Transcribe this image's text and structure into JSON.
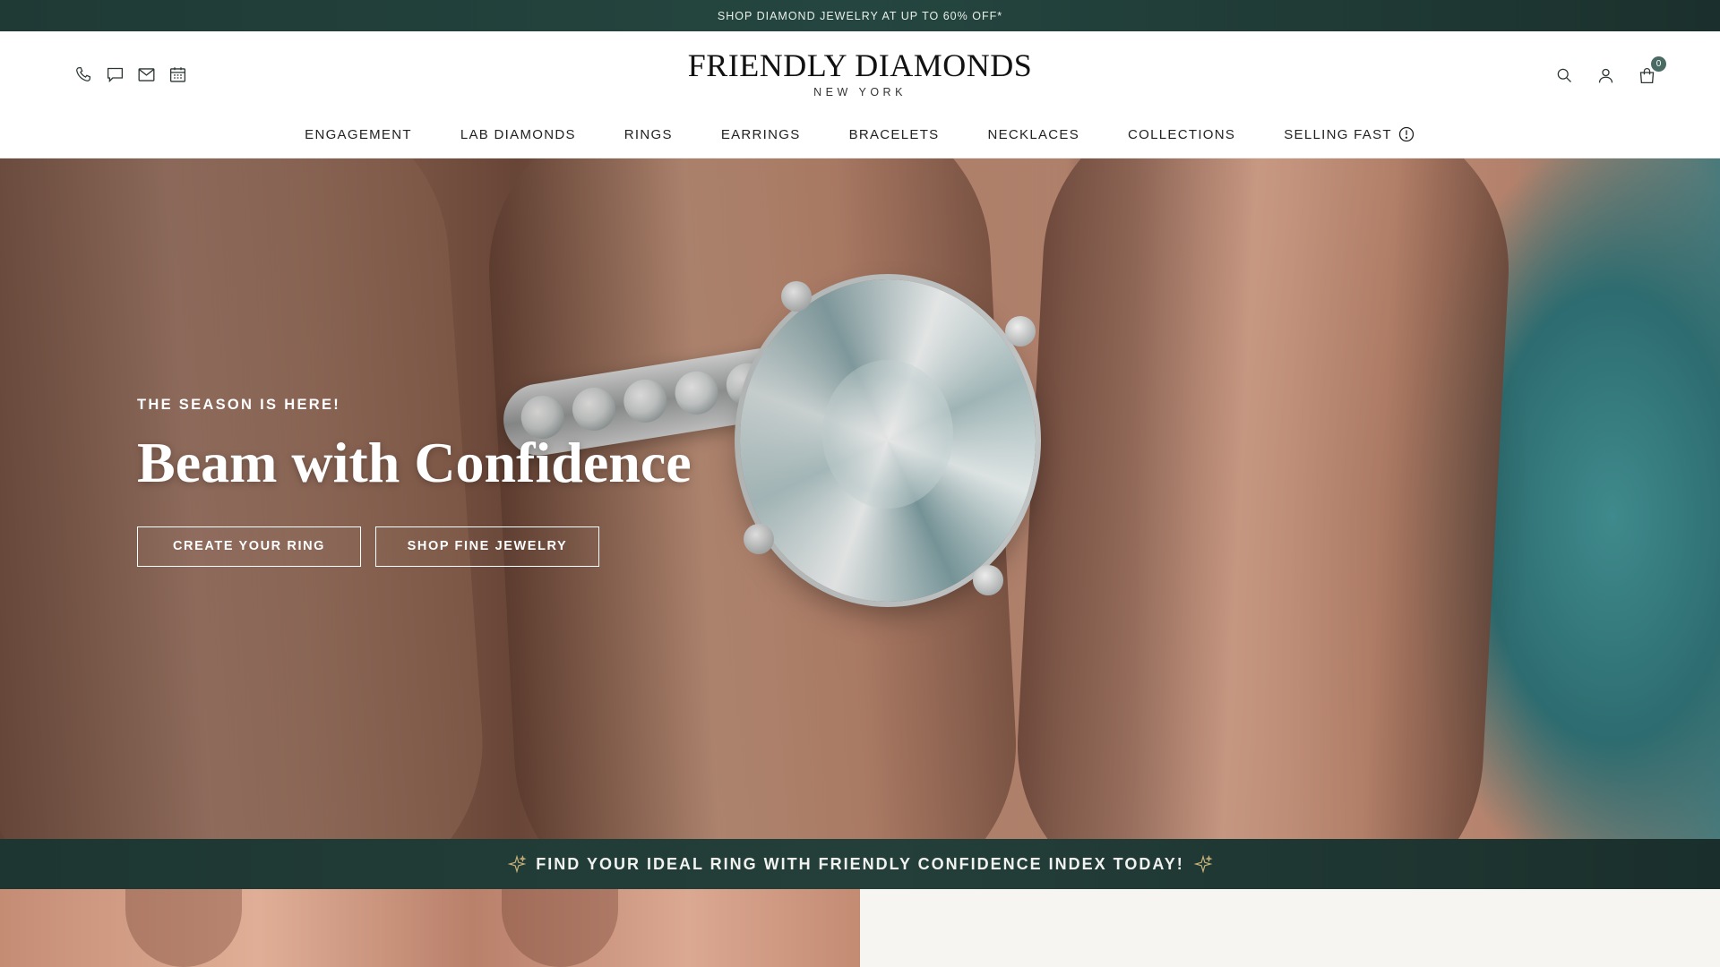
{
  "announcement": {
    "text": "SHOP DIAMOND JEWELRY AT UP TO 60% OFF*"
  },
  "header": {
    "utility_left": [
      "phone-icon",
      "chat-icon",
      "email-icon",
      "calendar-icon"
    ],
    "logo": {
      "name": "FRIENDLY DIAMONDS",
      "subtitle": "NEW YORK"
    },
    "utility_right": [
      "search-icon",
      "account-icon",
      "cart-icon"
    ],
    "cart_count": "0"
  },
  "nav": {
    "items": [
      {
        "label": "ENGAGEMENT"
      },
      {
        "label": "LAB DIAMONDS"
      },
      {
        "label": "RINGS"
      },
      {
        "label": "EARRINGS"
      },
      {
        "label": "BRACELETS"
      },
      {
        "label": "NECKLACES"
      },
      {
        "label": "COLLECTIONS"
      },
      {
        "label": "SELLING FAST",
        "icon": "clock-alert-icon"
      }
    ]
  },
  "hero": {
    "eyebrow": "THE SEASON IS HERE!",
    "headline": "Beam with Confidence",
    "cta_primary": "CREATE YOUR RING",
    "cta_secondary": "SHOP FINE JEWELRY"
  },
  "confidence_bar": {
    "text": "FIND YOUR IDEAL RING WITH FRIENDLY CONFIDENCE INDEX TODAY!",
    "icon": "sparkle-icon",
    "accent_color": "#c9b27a"
  },
  "colors": {
    "brand_dark_green": "#1f3a35",
    "cart_badge": "#4a6b63",
    "lower_panel": "#f7f5f1"
  }
}
